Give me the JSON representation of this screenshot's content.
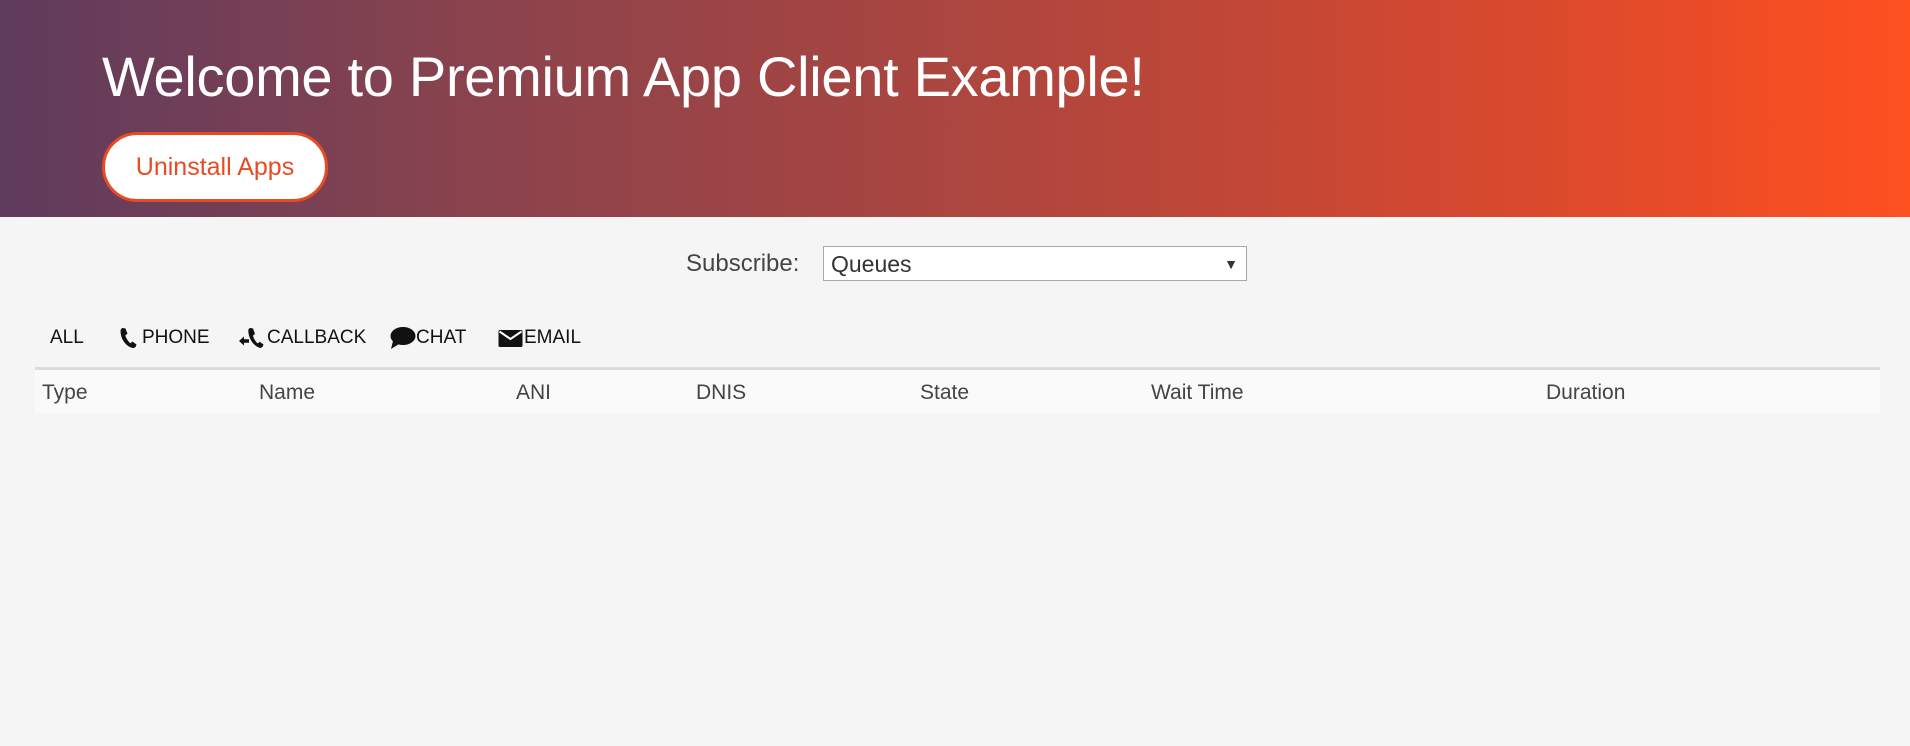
{
  "header": {
    "title": "Welcome to Premium App Client Example!",
    "uninstall_label": "Uninstall Apps",
    "gradient_start": "#5f3b5e",
    "gradient_end": "#ff5020",
    "accent_color": "#e84b23"
  },
  "subscribe": {
    "label": "Subscribe:",
    "selected": "Queues"
  },
  "filters": [
    {
      "label": "ALL",
      "icon": ""
    },
    {
      "label": "PHONE",
      "icon": "phone-icon"
    },
    {
      "label": "CALLBACK",
      "icon": "callback-icon"
    },
    {
      "label": "CHAT",
      "icon": "chat-icon"
    },
    {
      "label": "EMAIL",
      "icon": "email-icon"
    }
  ],
  "table": {
    "columns": [
      "Type",
      "Name",
      "ANI",
      "DNIS",
      "State",
      "Wait Time",
      "Duration"
    ],
    "rows": []
  }
}
